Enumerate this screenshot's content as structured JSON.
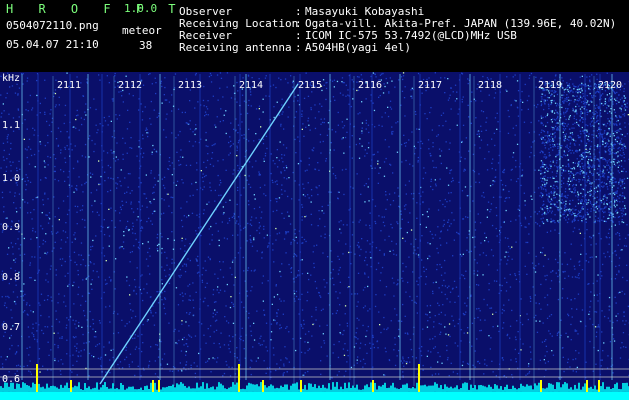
{
  "app": {
    "title": "H R O F F T",
    "version": "1.0.0"
  },
  "capture": {
    "file": "0504072110.png",
    "meteor_label": "meteor",
    "timestamp": "05.04.07 21:10",
    "meteor_count": "38"
  },
  "station": {
    "rows": [
      {
        "label": "Observer",
        "value": "Masayuki Kobayashi"
      },
      {
        "label": "Receiving Location",
        "value": "Ogata-vill. Akita-Pref. JAPAN (139.96E, 40.02N)"
      },
      {
        "label": "Receiver",
        "value": "ICOM IC-575 53.7492(@LCD)MHz USB"
      },
      {
        "label": "Receiving antenna",
        "value": "A504HB(yagi 4el)"
      }
    ],
    "separator": ":"
  },
  "chart_data": {
    "type": "heatmap",
    "ylabel": "kHz",
    "y_ticks": [
      "1.1",
      "1.0",
      "0.9",
      "0.8",
      "0.7",
      "0.6"
    ],
    "x_ticks": [
      "2111",
      "2112",
      "2113",
      "2114",
      "2115",
      "2116",
      "2117",
      "2118",
      "2119",
      "2120"
    ],
    "colors": {
      "background": "#0a0f6a",
      "noise": "#1d3ec4",
      "signal": "#6fd2ff",
      "strong": "#d8ffb0",
      "baseline": "#00ffff",
      "yellow": "#ffff00"
    }
  }
}
